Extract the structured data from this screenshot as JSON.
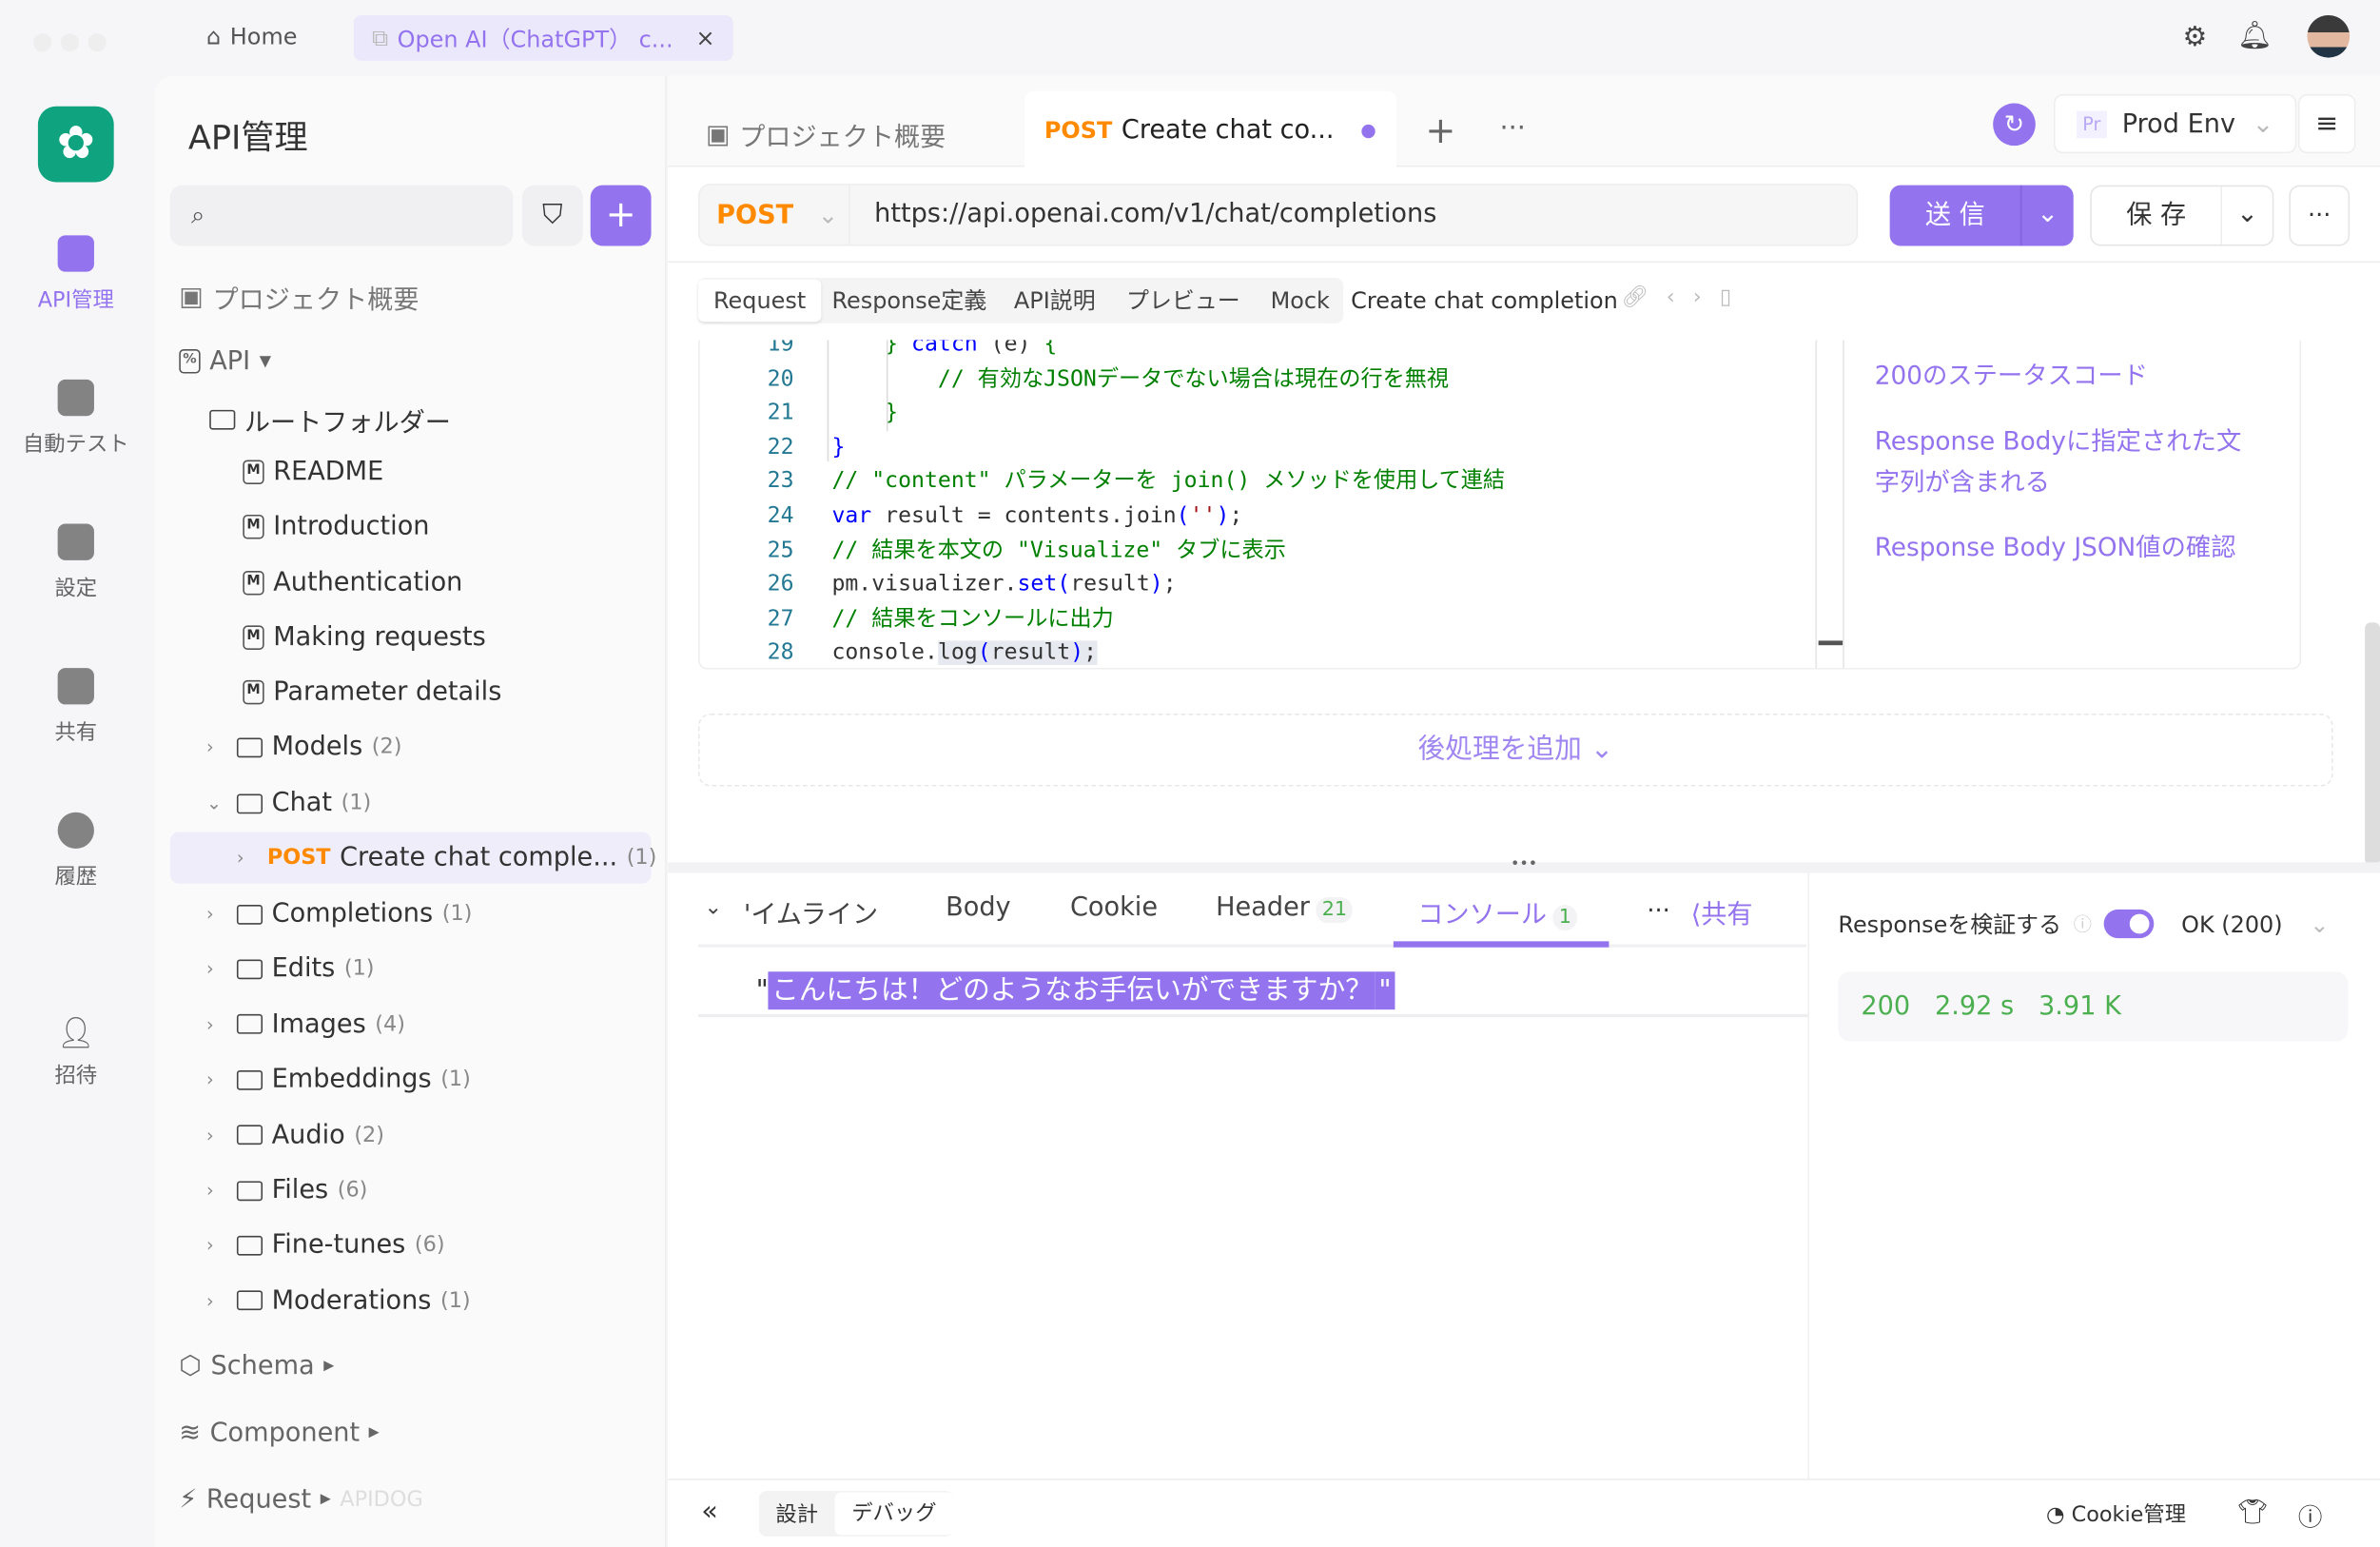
{
  "titlebar": {
    "home": "Home",
    "tab": "Open AI（ChatGPT） c...",
    "close": "×"
  },
  "rail": {
    "items": [
      {
        "label": "API管理",
        "active": true
      },
      {
        "label": "自動テスト"
      },
      {
        "label": "設定"
      },
      {
        "label": "共有"
      },
      {
        "label": "履歴"
      },
      {
        "label": "招待"
      }
    ]
  },
  "sidebar": {
    "title": "API管理",
    "overview": "プロジェクト概要",
    "api": "API",
    "root": "ルートフォルダー",
    "docs": [
      "README",
      "Introduction",
      "Authentication",
      "Making requests",
      "Parameter details"
    ],
    "folders": [
      {
        "name": "Models",
        "count": "(2)"
      },
      {
        "name": "Chat",
        "count": "(1)",
        "open": true
      }
    ],
    "endpoint": {
      "method": "POST",
      "name": "Create chat comple...",
      "count": "(1)"
    },
    "folders2": [
      {
        "name": "Completions",
        "count": "(1)"
      },
      {
        "name": "Edits",
        "count": "(1)"
      },
      {
        "name": "Images",
        "count": "(4)"
      },
      {
        "name": "Embeddings",
        "count": "(1)"
      },
      {
        "name": "Audio",
        "count": "(2)"
      },
      {
        "name": "Files",
        "count": "(6)"
      },
      {
        "name": "Fine-tunes",
        "count": "(6)"
      },
      {
        "name": "Moderations",
        "count": "(1)"
      }
    ],
    "schema": "Schema",
    "component": "Component",
    "request": "Request",
    "watermark": "APIDOG"
  },
  "tabs": {
    "overview": "プロジェクト概要",
    "active_method": "POST",
    "active_name": "Create chat co...",
    "env_badge": "Pr",
    "env": "Prod Env"
  },
  "request": {
    "method": "POST",
    "url": "https://api.openai.com/v1/chat/completions",
    "send": "送 信",
    "save": "保 存"
  },
  "subtabs": [
    "Request",
    "Response定義",
    "API説明",
    "プレビュー",
    "Mock"
  ],
  "endpoint_title": "Create chat completion",
  "code": [
    {
      "n": "19",
      "html": "    <span class='c'>} </span><span class='k'>catch</span> (e) <span class='c'>{</span>"
    },
    {
      "n": "20",
      "html": "        <span class='c'>// 有効なJSONデータでない場合は現在の行を無視</span>"
    },
    {
      "n": "21",
      "html": "    <span class='c'>}</span>"
    },
    {
      "n": "22",
      "html": "<span class='k'>}</span>"
    },
    {
      "n": "23",
      "html": "<span class='c'>// \"content\" パラメーターを join() メソッドを使用して連結</span>"
    },
    {
      "n": "24",
      "html": "<span class='k'>var</span> result = contents.join<span class='k'>(</span><span class='s'>''</span><span class='k'>)</span>;"
    },
    {
      "n": "25",
      "html": "<span class='c'>// 結果を本文の \"Visualize\" タブに表示</span>"
    },
    {
      "n": "26",
      "html": "pm.visualizer.<span class='k'>set(</span>result<span class='k'>)</span>;"
    },
    {
      "n": "27",
      "html": "<span class='c'>// 結果をコンソールに出力</span>"
    },
    {
      "n": "28",
      "html": "console.<span style='background:#e6e9f0'>log<span class='k'>(</span>result<span class='k'>)</span>;</span>"
    }
  ],
  "snippets": [
    "200のステータスコード",
    "Response Bodyに指定された文字列が含まれる",
    "Response Body JSON値の確認"
  ],
  "add_post": "後処理を追加",
  "response": {
    "tabs": [
      {
        "label": "'イムライン"
      },
      {
        "label": "Body"
      },
      {
        "label": "Cookie"
      },
      {
        "label": "Header",
        "badge": "21"
      },
      {
        "label": "コンソール",
        "badge": "1",
        "active": true
      }
    ],
    "share": "共有",
    "console_text": "こんにちは！どのようなお手伝いができますか？",
    "validate": "Responseを検証する",
    "validate_on": true,
    "status_select": "OK (200)",
    "status": "200",
    "time": "2.92 s",
    "size": "3.91 K"
  },
  "footer": {
    "design": "設計",
    "debug": "デバッグ",
    "cookie": "Cookie管理"
  },
  "colors": {
    "accent": "#9373ee",
    "post": "#ff8a00",
    "green": "#4caf50",
    "logo": "#10a37f"
  }
}
